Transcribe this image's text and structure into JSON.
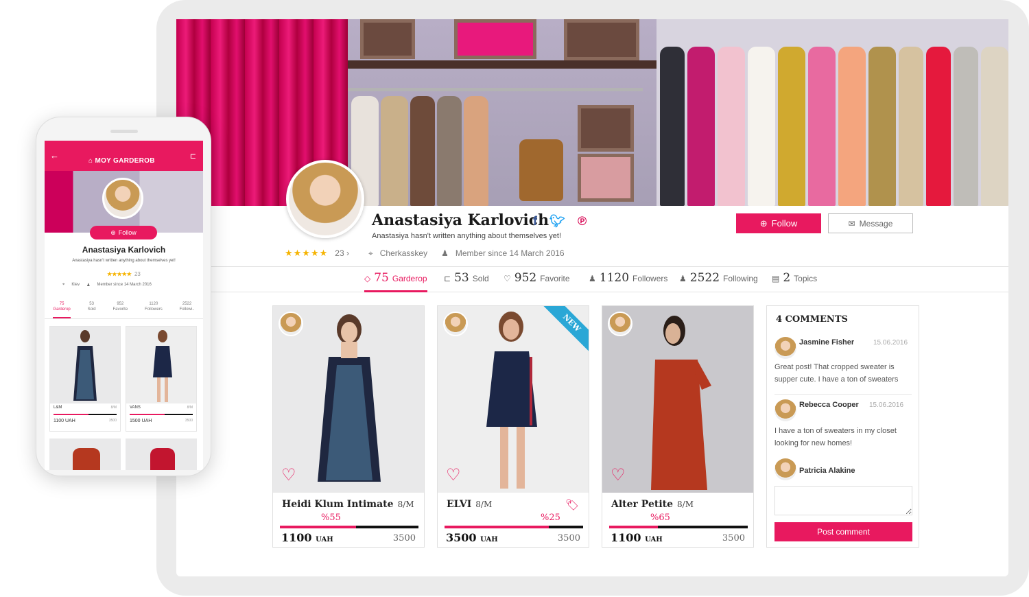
{
  "colors": {
    "accent": "#e8195f",
    "star": "#f5b300",
    "facebook": "#3b5998",
    "twitter": "#1da1f2",
    "pinterest": "#d6004f",
    "new_ribbon": "#2aa7d6"
  },
  "profile": {
    "name": "Anastasiya Karlovich",
    "about": "Anastasiya hasn't written anything about themselves yet!",
    "rating_stars": "★★★★★",
    "reviews": "23 ›",
    "location": "Cherkasskey",
    "member_since": "Member since 14 March 2016"
  },
  "actions": {
    "follow": "Follow",
    "message": "Message"
  },
  "tabs": [
    {
      "num": "75",
      "label": "Garderop"
    },
    {
      "num": "53",
      "label": "Sold"
    },
    {
      "num": "952",
      "label": "Favorite"
    },
    {
      "num": "1120",
      "label": "Followers"
    },
    {
      "num": "2522",
      "label": "Following"
    },
    {
      "num": "2",
      "label": "Topics"
    }
  ],
  "products": [
    {
      "brand": "Heidi Klum Intimate",
      "size": "8/M",
      "discount": "%55",
      "price": "1100",
      "currency": "UAH",
      "old_price": "3500",
      "discount_level": 0.55
    },
    {
      "brand": "ELVI",
      "size": "8/M",
      "discount": "%25",
      "price": "3500",
      "currency": "UAH",
      "old_price": "3500",
      "badge": "NEW",
      "discount_level": 0.75
    },
    {
      "brand": "Alter Petite",
      "size": "8/M",
      "discount": "%65",
      "price": "1100",
      "currency": "UAH",
      "old_price": "3500",
      "discount_level": 0.35
    }
  ],
  "comments": {
    "title": "4 COMMENTS",
    "items": [
      {
        "author": "Jasmine Fisher",
        "date": "15.06.2016",
        "text": "Great post! That cropped sweater is supper cute. I have a ton of sweaters"
      },
      {
        "author": "Rebecca Cooper",
        "date": "15.06.2016",
        "text": "I have a ton of sweaters in my closet looking for new homes!"
      },
      {
        "author": "Patricia Alakine"
      }
    ],
    "post_button": "Post comment"
  },
  "mobile": {
    "logo": "MOY GARDEROB",
    "follow": "Follow",
    "name": "Anastasiya Karlovich",
    "about": "Anastasiya hasn't written anything about themselves yet!",
    "stars": "★★★★★",
    "reviews": "23",
    "location": "Kiev",
    "member_since": "Member since 14 March 2016",
    "tabs": [
      {
        "num": "75",
        "label": "Garderop"
      },
      {
        "num": "53",
        "label": "Sold"
      },
      {
        "num": "952",
        "label": "Favorite"
      },
      {
        "num": "1120",
        "label": "Followers"
      },
      {
        "num": "2522",
        "label": "Followi.."
      }
    ],
    "cards": [
      {
        "brand": "L&M",
        "size": "8/M",
        "price": "1100 UAH",
        "old": "3500"
      },
      {
        "brand": "VANS",
        "size": "8/M",
        "price": "1500 UAH",
        "old": "3500"
      }
    ]
  }
}
